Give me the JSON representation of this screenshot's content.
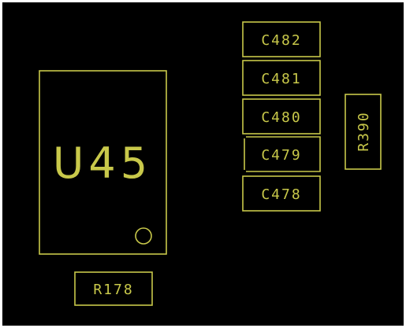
{
  "colors": {
    "background": "#000000",
    "silkscreen": "#c8c84a",
    "border": "#ffffff"
  },
  "components": {
    "u45": {
      "designator": "U45",
      "type": "ic-package",
      "pin1_marker": "circle"
    },
    "r178": {
      "designator": "R178",
      "type": "resistor"
    },
    "r390": {
      "designator": "R390",
      "type": "resistor",
      "orientation": "vertical"
    },
    "c482": {
      "designator": "C482",
      "type": "capacitor"
    },
    "c481": {
      "designator": "C481",
      "type": "capacitor"
    },
    "c480": {
      "designator": "C480",
      "type": "capacitor"
    },
    "c479": {
      "designator": "C479",
      "type": "capacitor"
    },
    "c478": {
      "designator": "C478",
      "type": "capacitor"
    }
  }
}
